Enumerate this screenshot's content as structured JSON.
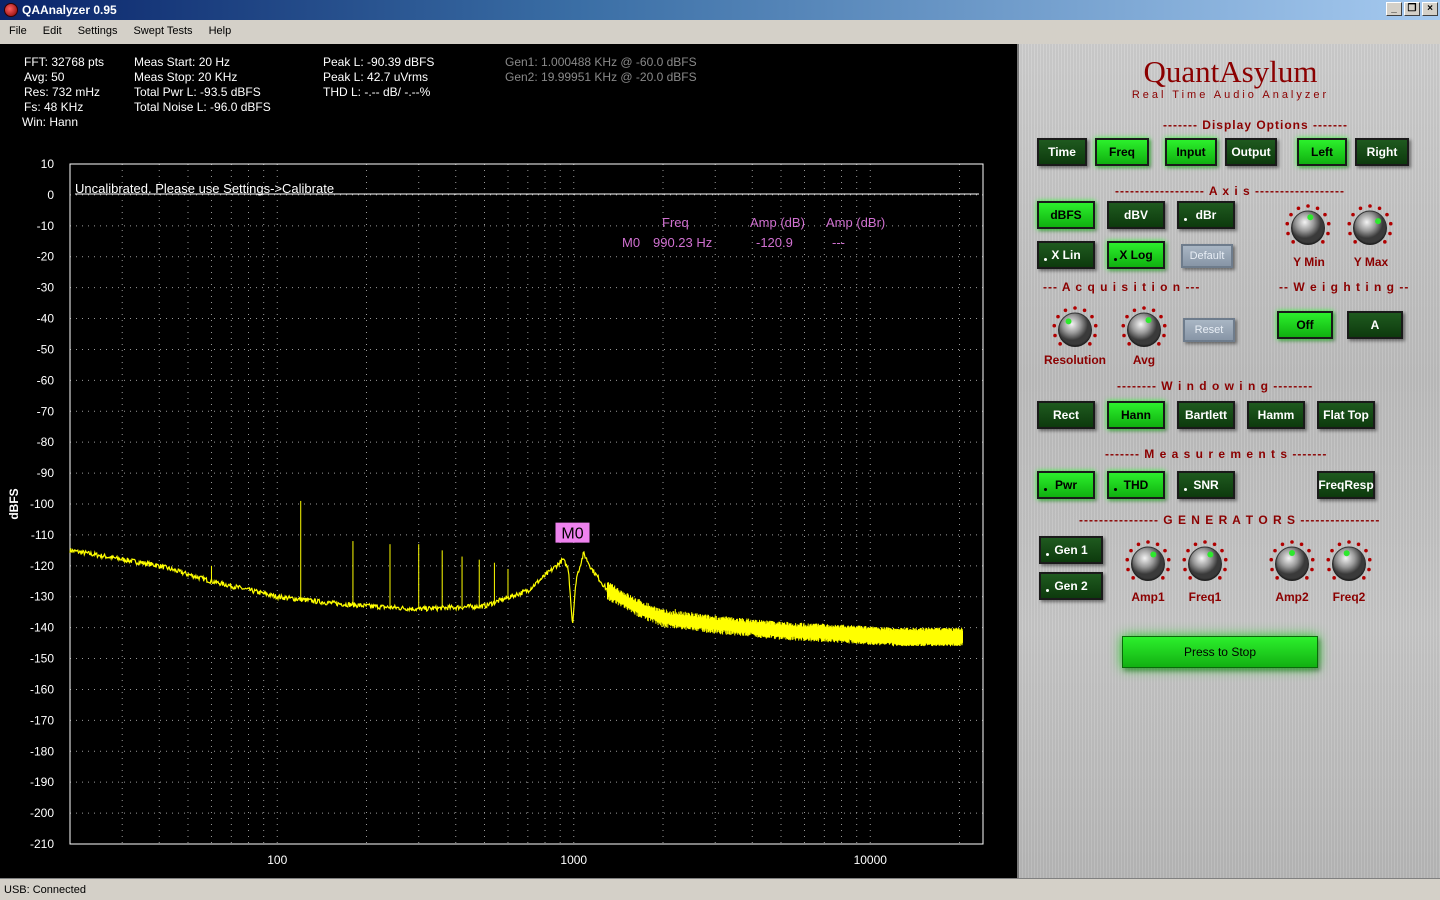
{
  "window": {
    "title": "QAAnalyzer 0.95"
  },
  "menu": [
    "File",
    "Edit",
    "Settings",
    "Swept Tests",
    "Help"
  ],
  "info": {
    "col1": [
      "FFT: 32768 pts",
      "Avg: 50",
      "Res: 732 mHz",
      "Fs: 48 KHz",
      "Win: Hann"
    ],
    "col2": [
      "Meas Start: 20 Hz",
      "Meas Stop: 20 KHz",
      "Total Pwr L: -93.5 dBFS",
      "",
      "Total Noise L: -96.0 dBFS"
    ],
    "col3": [
      "Peak L: -90.39 dBFS",
      "",
      "Peak L: 42.7 uVrms",
      "",
      "THD L: -.-- dB/ -.--%"
    ],
    "gen": [
      "Gen1: 1.000488 KHz @ -60.0 dBFS",
      "Gen2: 19.99951 KHz @ -20.0 dBFS"
    ]
  },
  "plot": {
    "calibration_note": "Uncalibrated. Please use Settings->Calibrate",
    "marker_table": {
      "headers": [
        "Freq",
        "Amp (dB)",
        "Amp (dBr)"
      ],
      "row": {
        "id": "M0",
        "freq": "990.23 Hz",
        "amp_db": "-120.9",
        "amp_dbr": "---"
      }
    },
    "marker_label": "M0"
  },
  "chart_data": {
    "type": "line",
    "xscale": "log",
    "xlim": [
      20,
      24000
    ],
    "ylim": [
      -210,
      10
    ],
    "ylabel": "dBFS",
    "x_ticks": [
      "100",
      "1000",
      "10000"
    ],
    "y_ticks": [
      10,
      0,
      -10,
      -20,
      -30,
      -40,
      -50,
      -60,
      -70,
      -80,
      -90,
      -100,
      -110,
      -120,
      -130,
      -140,
      -150,
      -160,
      -170,
      -180,
      -190,
      -200,
      -210
    ],
    "grid": true,
    "series_color": "#ffff00",
    "noise_floor": [
      [
        20,
        -115
      ],
      [
        40,
        -120
      ],
      [
        60,
        -125
      ],
      [
        100,
        -130
      ],
      [
        150,
        -132
      ],
      [
        200,
        -133
      ],
      [
        300,
        -134
      ],
      [
        500,
        -133
      ],
      [
        700,
        -128
      ],
      [
        850,
        -121
      ],
      [
        920,
        -118
      ],
      [
        960,
        -121
      ],
      [
        990,
        -139
      ],
      [
        1020,
        -124
      ],
      [
        1080,
        -116
      ],
      [
        1150,
        -121
      ],
      [
        1300,
        -128
      ],
      [
        1600,
        -133
      ],
      [
        2000,
        -137
      ],
      [
        3000,
        -139
      ],
      [
        5000,
        -141
      ],
      [
        8000,
        -142
      ],
      [
        12000,
        -143
      ],
      [
        20000,
        -143
      ],
      [
        24000,
        -142
      ]
    ],
    "spikes": [
      [
        60,
        -120
      ],
      [
        120,
        -99
      ],
      [
        180,
        -112
      ],
      [
        240,
        -113
      ],
      [
        300,
        -113
      ],
      [
        360,
        -115
      ],
      [
        420,
        -117
      ],
      [
        480,
        -118
      ],
      [
        540,
        -119
      ],
      [
        600,
        -121
      ],
      [
        1500,
        -132
      ],
      [
        1800,
        -133
      ],
      [
        2200,
        -134
      ],
      [
        2500,
        -135
      ],
      [
        3000,
        -136
      ],
      [
        4000,
        -138
      ],
      [
        5000,
        -139
      ],
      [
        7000,
        -139
      ],
      [
        10000,
        -140
      ]
    ],
    "marker": {
      "name": "M0",
      "freq": 990.23,
      "amp": -120.9
    }
  },
  "panel": {
    "brand": "QuantAsylum",
    "subtitle": "Real Time Audio Analyzer",
    "sections": {
      "display": "------- Display Options -------",
      "axis": "------------------ A x i s ------------------",
      "acq": "--- A c q u i s i t i o n ---",
      "weight": "-- W e i g h t i n g --",
      "window": "-------- W i n d o w i n g --------",
      "meas": "------- M e a s u r e m e n t s -------",
      "gen": "---------------- G E N E R A T O R S ----------------"
    },
    "buttons": {
      "time": "Time",
      "freq": "Freq",
      "input": "Input",
      "output": "Output",
      "left": "Left",
      "right": "Right",
      "dbfs": "dBFS",
      "dbv": "dBV",
      "dbr": "dBr",
      "xlin": "X Lin",
      "xlog": "X Log",
      "default": "Default",
      "reset": "Reset",
      "off": "Off",
      "a": "A",
      "rect": "Rect",
      "hann": "Hann",
      "bartlett": "Bartlett",
      "hamm": "Hamm",
      "flattop": "Flat Top",
      "pwr": "Pwr",
      "thd": "THD",
      "snr": "SNR",
      "freqresp": "FreqResp",
      "gen1": "Gen 1",
      "gen2": "Gen 2",
      "stop": "Press to Stop"
    },
    "knobs": {
      "ymin": "Y Min",
      "ymax": "Y Max",
      "resolution": "Resolution",
      "avg": "Avg",
      "amp1": "Amp1",
      "freq1": "Freq1",
      "amp2": "Amp2",
      "freq2": "Freq2"
    }
  },
  "status": "USB: Connected"
}
